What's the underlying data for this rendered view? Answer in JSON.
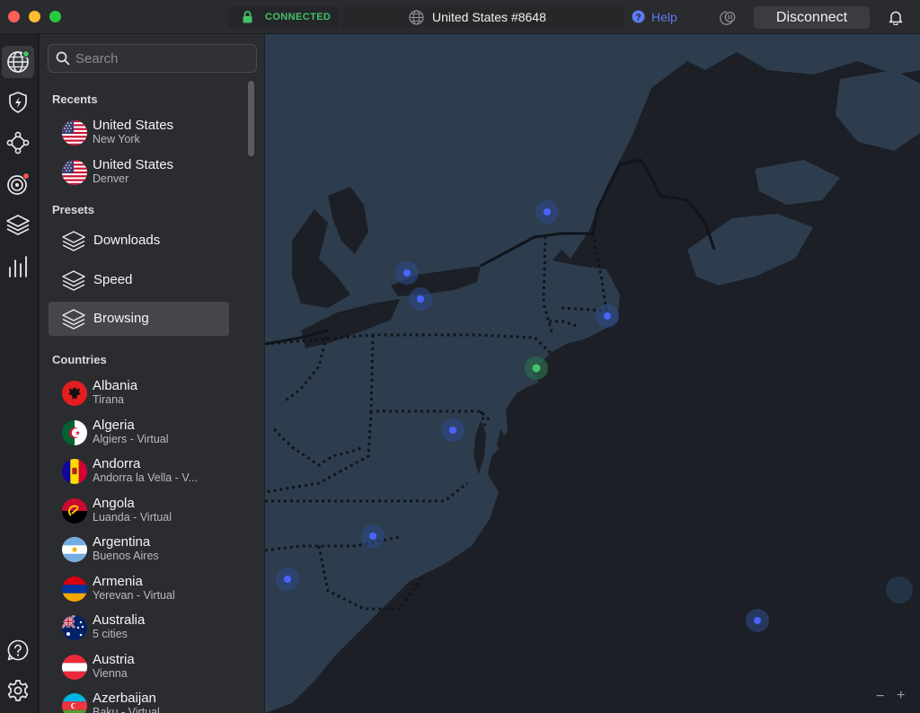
{
  "titlebar": {
    "status": "CONNECTED",
    "server": "United States #8648",
    "help": "Help",
    "disconnect": "Disconnect"
  },
  "search": {
    "placeholder": "Search"
  },
  "sidebar": {
    "recents_title": "Recents",
    "recents": [
      {
        "name": "United States",
        "sub": "New York",
        "flag": "us"
      },
      {
        "name": "United States",
        "sub": "Denver",
        "flag": "us"
      }
    ],
    "presets_title": "Presets",
    "presets": [
      {
        "label": "Downloads",
        "selected": false
      },
      {
        "label": "Speed",
        "selected": false
      },
      {
        "label": "Browsing",
        "selected": true
      }
    ],
    "countries_title": "Countries",
    "countries": [
      {
        "name": "Albania",
        "sub": "Tirana",
        "flag": "al"
      },
      {
        "name": "Algeria",
        "sub": "Algiers - Virtual",
        "flag": "dz"
      },
      {
        "name": "Andorra",
        "sub": "Andorra la Vella - V...",
        "flag": "ad"
      },
      {
        "name": "Angola",
        "sub": "Luanda - Virtual",
        "flag": "ao"
      },
      {
        "name": "Argentina",
        "sub": "Buenos Aires",
        "flag": "ar"
      },
      {
        "name": "Armenia",
        "sub": "Yerevan - Virtual",
        "flag": "am"
      },
      {
        "name": "Australia",
        "sub": "5 cities",
        "flag": "au"
      },
      {
        "name": "Austria",
        "sub": "Vienna",
        "flag": "at"
      },
      {
        "name": "Azerbaijan",
        "sub": "Baku - Virtual",
        "flag": "az"
      }
    ]
  },
  "rail": [
    {
      "icon": "globe-icon",
      "active": true,
      "badge": "#44c267"
    },
    {
      "icon": "shield-bolt-icon",
      "active": false
    },
    {
      "icon": "meshnet-icon",
      "active": false
    },
    {
      "icon": "target-icon",
      "active": false,
      "badge": "#ef5350"
    },
    {
      "icon": "layers-icon",
      "active": false
    },
    {
      "icon": "stats-icon",
      "active": false
    },
    {
      "icon": "support-icon",
      "active": false
    },
    {
      "icon": "settings-icon",
      "active": false
    }
  ],
  "map": {
    "connected_pin_color": "#44c267",
    "pin_color": "#4a63ff"
  },
  "colors": {
    "connected": "#44c267",
    "accent": "#5a7bf0",
    "notify": "#ef5350"
  }
}
